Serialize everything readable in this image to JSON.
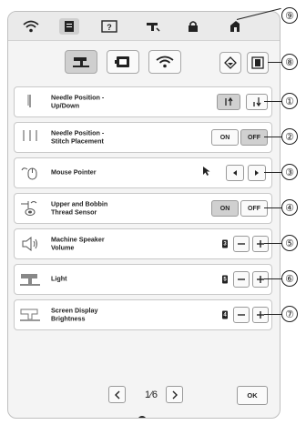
{
  "top_tabs": [
    "wifi-icon",
    "document-icon",
    "help-icon",
    "sewing-machine-settings-icon",
    "lock-icon",
    "embroidery-icon"
  ],
  "category_tabs": [
    "sewing-machine-icon",
    "embroidery-frame-icon",
    "wifi-icon"
  ],
  "rows": [
    {
      "label": "Needle Position -\nUp/Down",
      "callout": "①"
    },
    {
      "label": "Needle Position -\nStitch Placement",
      "on": "ON",
      "off": "OFF",
      "callout": "②"
    },
    {
      "label": "Mouse Pointer",
      "callout": "③"
    },
    {
      "label": "Upper and Bobbin\nThread Sensor",
      "on": "ON",
      "off": "OFF",
      "callout": "④"
    },
    {
      "label": "Machine Speaker\nVolume",
      "level": "3",
      "callout": "⑤"
    },
    {
      "label": "Light",
      "level": "5",
      "callout": "⑥"
    },
    {
      "label": "Screen Display\nBrightness",
      "level": "4",
      "callout": "⑦"
    }
  ],
  "callouts_top": {
    "eraser": "⑨",
    "frame": "⑧"
  },
  "pager": {
    "page": "1⁄6"
  },
  "ok_label": "OK"
}
